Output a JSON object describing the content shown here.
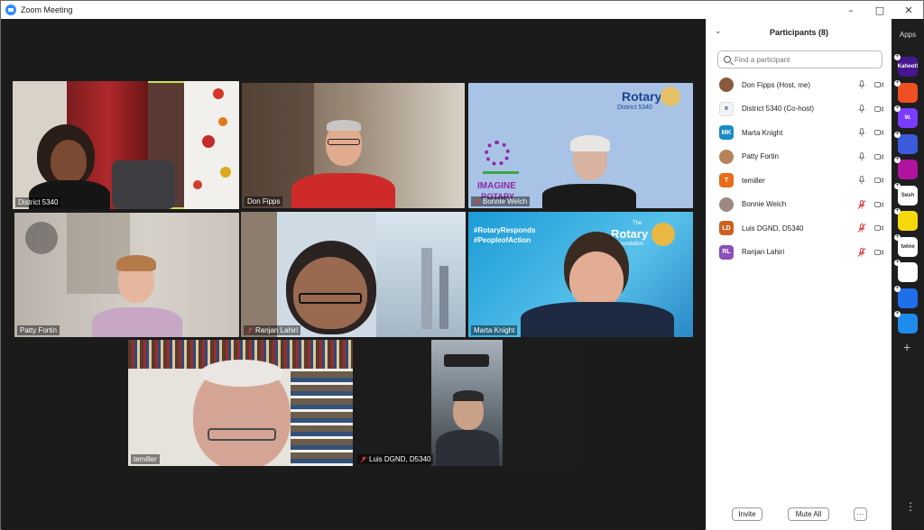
{
  "window": {
    "title": "Zoom Meeting"
  },
  "tiles": [
    {
      "name": "District 5340",
      "mic_muted": false
    },
    {
      "name": "Don Fipps",
      "mic_muted": false
    },
    {
      "name": "Bonnie Welch",
      "mic_muted": true
    },
    {
      "name": "Patty Fortin",
      "mic_muted": false
    },
    {
      "name": "Ranjan Lahiri",
      "mic_muted": true
    },
    {
      "name": "Marta Knight",
      "mic_muted": false
    },
    {
      "name": "temiller",
      "mic_muted": false
    },
    {
      "name": "Luis DGND, D5340",
      "mic_muted": true
    }
  ],
  "backgrounds": {
    "rotary_district": {
      "brand": "Rotary",
      "sub": "District 5340",
      "imagine": "IMAGINE",
      "imagine2": "ROTARY"
    },
    "foundation": {
      "hashtag1": "#RotaryResponds",
      "hashtag2": "#PeopleofAction",
      "the": "The",
      "brand": "Rotary",
      "sub": "Foundation"
    }
  },
  "participants": {
    "title": "Participants (8)",
    "search_placeholder": "Find a participant",
    "list": [
      {
        "name": "Don Fipps (Host, me)",
        "avatar": "photo",
        "initials": "",
        "color": "#8a5a3c",
        "mic_muted": false
      },
      {
        "name": "District 5340 (Co-host)",
        "avatar": "logo",
        "initials": "",
        "color": "#f4f4f4",
        "mic_muted": false
      },
      {
        "name": "Marta Knight",
        "avatar": "initials",
        "initials": "MK",
        "color": "#1a8bc8",
        "mic_muted": false
      },
      {
        "name": "Patty Fortin",
        "avatar": "photo",
        "initials": "",
        "color": "#b7835a",
        "mic_muted": false
      },
      {
        "name": "temiller",
        "avatar": "initials",
        "initials": "T",
        "color": "#e86c1a",
        "mic_muted": false
      },
      {
        "name": "Bonnie Welch",
        "avatar": "photo",
        "initials": "",
        "color": "#9c8a82",
        "mic_muted": true
      },
      {
        "name": "Luis DGND, D5340",
        "avatar": "initials",
        "initials": "LD",
        "color": "#d0601f",
        "mic_muted": true
      },
      {
        "name": "Ranjan Lahiri",
        "avatar": "initials",
        "initials": "RL",
        "color": "#8a4fb8",
        "mic_muted": true
      }
    ],
    "invite_label": "Invite",
    "mute_all_label": "Mute All",
    "more_label": "···"
  },
  "apps": {
    "title": "Apps",
    "items": [
      {
        "icon": "kahoot-icon",
        "label": "Kahoot!",
        "color": "#46178f"
      },
      {
        "icon": "orange-app-icon",
        "label": "",
        "color": "#f04e23"
      },
      {
        "icon": "wooclap-icon",
        "label": "W.",
        "color": "#7a3cff"
      },
      {
        "icon": "blue-circle-app-icon",
        "label": "",
        "color": "#3b5bdb"
      },
      {
        "icon": "camera-app-icon",
        "label": "",
        "color": "#b0139e"
      },
      {
        "icon": "sesh-icon",
        "label": "Sesh",
        "color": "#ffffff"
      },
      {
        "icon": "sticker-app-icon",
        "label": "",
        "color": "#f5d90a"
      },
      {
        "icon": "twine-icon",
        "label": "twine",
        "color": "#ffffff"
      },
      {
        "icon": "grid-app-icon",
        "label": "",
        "color": "#ffffff"
      },
      {
        "icon": "sync-app-icon",
        "label": "",
        "color": "#1f6feb"
      },
      {
        "icon": "zapp-icon",
        "label": "",
        "color": "#1f8ceb"
      }
    ],
    "add_label": "+",
    "more_label": "⋮"
  }
}
